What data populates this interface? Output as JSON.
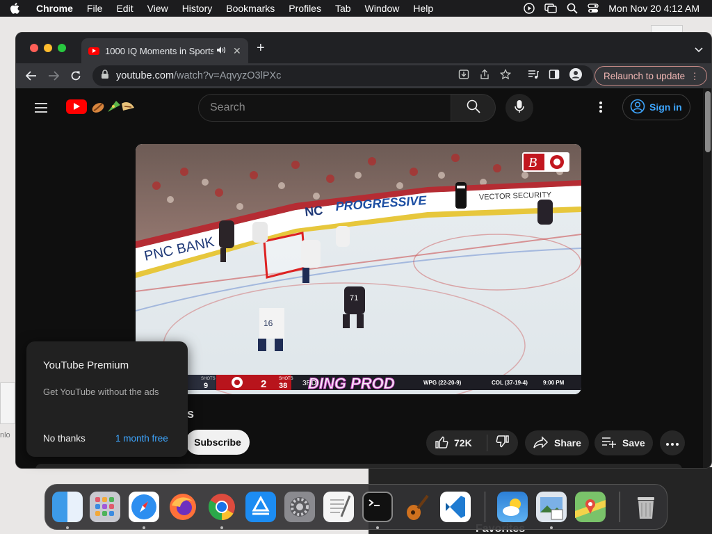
{
  "menubar": {
    "app": "Chrome",
    "items": [
      "File",
      "Edit",
      "View",
      "History",
      "Bookmarks",
      "Profiles",
      "Tab",
      "Window",
      "Help"
    ],
    "datetime": "Mon Nov 20  4:12 AM"
  },
  "browser": {
    "tab_title": "1000 IQ Moments in Sports",
    "url_host": "youtube.com",
    "url_path": "/watch?v=AqvyzO3lPXc",
    "relaunch_label": "Relaunch to update"
  },
  "youtube": {
    "search_placeholder": "Search",
    "sign_in": "Sign in",
    "channel_fragment": "s",
    "subscribe": "Subscribe",
    "likes": "72K",
    "share": "Share",
    "save": "Save"
  },
  "video": {
    "arena_ads": [
      "PNC BANK",
      "NC",
      "PROGRESSIVE",
      "VECTOR SECURITY"
    ],
    "corner_logo": "B",
    "watermark": "DING PROD",
    "scorebug": {
      "left_team_shots_label": "SHOTS",
      "left_team_shots": "9",
      "home_score": "2",
      "home_shots_label": "SHOTS",
      "home_shots": "38",
      "period": "3RD",
      "standings_1": "WPG (22-20-9)",
      "standings_2": "COL (37-19-4)",
      "game_time": "9:00 PM"
    },
    "jersey_numbers": [
      "16",
      "71"
    ]
  },
  "premium_popup": {
    "title": "YouTube Premium",
    "description": "Get YouTube without the ads",
    "decline": "No thanks",
    "accept": "1 month free"
  },
  "desktop": {
    "left_text": "nlo",
    "favorites": "Favorites"
  },
  "dock": {
    "apps": [
      "finder-icon",
      "launchpad-icon",
      "safari-icon",
      "firefox-icon",
      "chrome-icon",
      "app-store-icon",
      "system-settings-icon",
      "textedit-icon",
      "terminal-icon",
      "garageband-icon",
      "vscode-icon",
      "weather-icon",
      "preview-icon",
      "maps-icon",
      "trash-icon"
    ]
  },
  "colors": {
    "yt_red": "#ff0000",
    "link_blue": "#3ea6ff",
    "page_bg": "#0f0f0f"
  }
}
